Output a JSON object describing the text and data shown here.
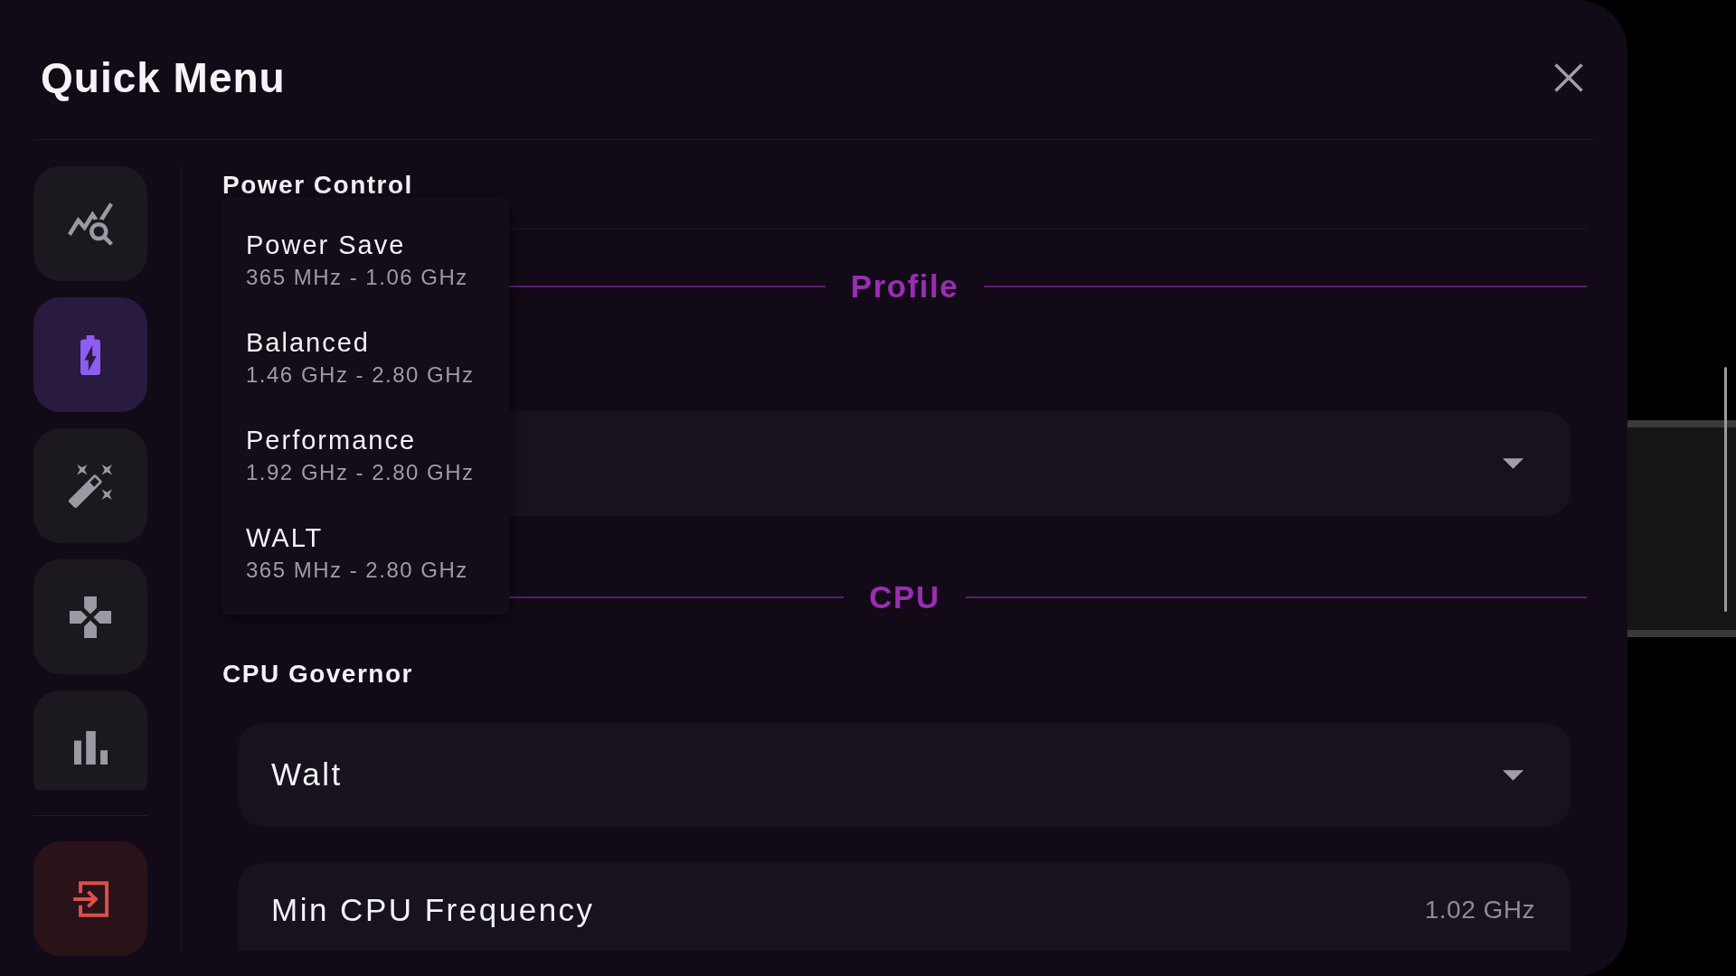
{
  "window": {
    "title": "Quick Menu"
  },
  "sidebar": {
    "items": [
      {
        "selected": false
      },
      {
        "selected": true
      },
      {
        "selected": false
      },
      {
        "selected": false
      },
      {
        "selected": false
      }
    ]
  },
  "content": {
    "heading": "Power Control",
    "profile": {
      "divider_label": "Profile",
      "select": {
        "expanded": true
      },
      "options": [
        {
          "name": "Power Save",
          "range": "365 MHz - 1.06 GHz"
        },
        {
          "name": "Balanced",
          "range": "1.46 GHz - 2.80 GHz"
        },
        {
          "name": "Performance",
          "range": "1.92 GHz - 2.80 GHz"
        },
        {
          "name": "WALT",
          "range": "365 MHz - 2.80 GHz"
        }
      ]
    },
    "cpu": {
      "divider_label": "CPU",
      "governor": {
        "label": "CPU Governor",
        "value": "Walt"
      },
      "min_frequency": {
        "label": "Min CPU Frequency",
        "value": "1.02 GHz"
      }
    }
  }
}
